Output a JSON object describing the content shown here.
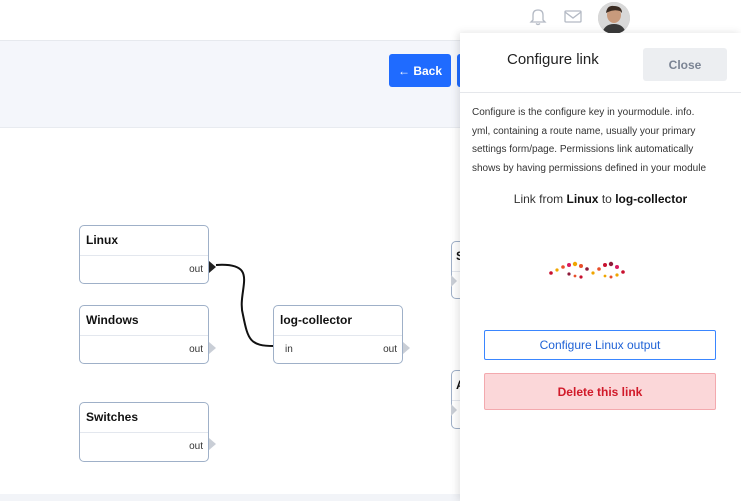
{
  "toolbar": {
    "back_label": "← Back"
  },
  "nodes": [
    {
      "title": "Linux",
      "port": "out"
    },
    {
      "title": "Windows",
      "port": "out"
    },
    {
      "title": "Switches",
      "port": "out"
    },
    {
      "title": "log-collector",
      "in_port": "in",
      "out_port": "out"
    },
    {
      "title": "S"
    },
    {
      "title": "A"
    }
  ],
  "panel": {
    "title": "Configure link",
    "close_label": "Close",
    "description_lines": [
      "Configure is the configure key in yourmodule. info.",
      "yml, containing a route name, usually your primary",
      "settings form/page. Permissions link automatically",
      "shows by having permissions defined in your module"
    ],
    "link_prefix": "Link from",
    "link_source": "Linux",
    "link_mid": "to",
    "link_target": "log-collector",
    "configure_label": "Configure Linux output",
    "delete_label": "Delete this link"
  },
  "colors": {
    "primary": "#1f6bff",
    "danger_bg": "#fbd7d9",
    "danger_text": "#d11a2a",
    "node_border": "#9fb0c8"
  },
  "icons": {
    "notifications": "bell-icon",
    "messages": "mail-icon",
    "user": "avatar"
  }
}
